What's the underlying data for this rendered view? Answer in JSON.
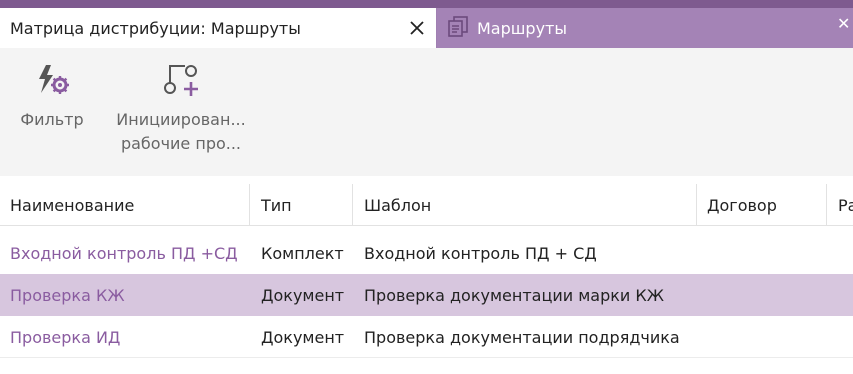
{
  "tabs": [
    {
      "label": "Матрица дистрибуции: Маршруты",
      "active": true,
      "close_icon": "close-icon"
    },
    {
      "label": "Маршруты",
      "active": false,
      "icon": "documents-icon"
    }
  ],
  "toolbar": {
    "filter_label": "Фильтр",
    "init_label_line1": "Инициирован...",
    "init_label_line2": "рабочие про..."
  },
  "table": {
    "columns": [
      "Наименование",
      "Тип",
      "Шаблон",
      "Договор",
      "Ра"
    ],
    "rows": [
      {
        "name": "Входной контроль ПД +СД",
        "type": "Комплект",
        "template": "Входной контроль ПД + СД",
        "contract": "",
        "selected": false
      },
      {
        "name": "Проверка КЖ",
        "type": "Документ",
        "template": "Проверка документации марки КЖ",
        "contract": "",
        "selected": true
      },
      {
        "name": "Проверка ИД",
        "type": "Документ",
        "template": "Проверка документации подрядчика",
        "contract": "",
        "selected": false
      }
    ]
  },
  "colors": {
    "accent": "#7e5a8f",
    "tab_inactive": "#a483b6",
    "selected_row": "#d7c6de",
    "link": "#8a5ca0"
  }
}
